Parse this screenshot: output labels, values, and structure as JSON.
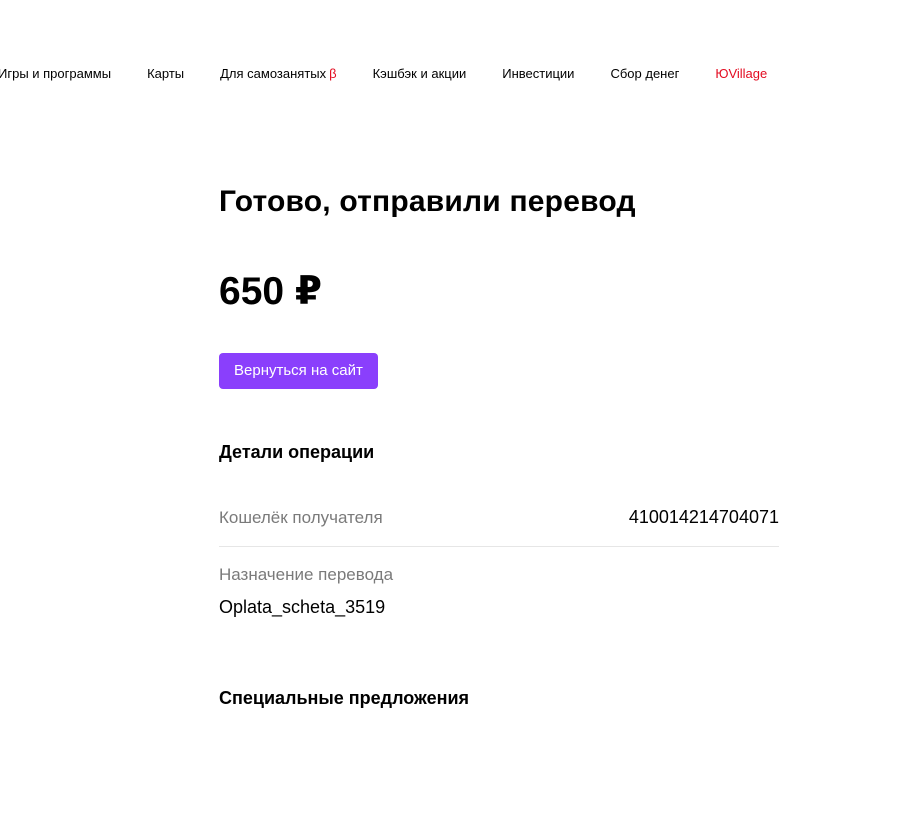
{
  "nav": {
    "items": [
      {
        "label": "Игры и программы"
      },
      {
        "label": "Карты"
      },
      {
        "label": "Для самозанятых",
        "badge": "β"
      },
      {
        "label": "Кэшбэк и акции"
      },
      {
        "label": "Инвестиции"
      },
      {
        "label": "Сбор денег"
      },
      {
        "label": "ЮVillage",
        "accent": "#e30b20"
      }
    ]
  },
  "success": {
    "title": "Готово, отправили перевод",
    "amount": "650 ₽",
    "back_button_label": "Вернуться на сайт",
    "button_color": "#8a3ffc"
  },
  "details": {
    "heading": "Детали операции",
    "wallet_label": "Кошелёк получателя",
    "wallet_value": "410014214704071",
    "purpose_label": "Назначение перевода",
    "purpose_value": "Oplata_scheta_3519"
  },
  "offers": {
    "heading": "Специальные предложения"
  }
}
